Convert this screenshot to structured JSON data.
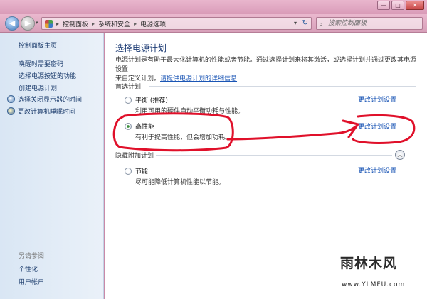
{
  "window": {
    "min_label": "—",
    "max_label": "□",
    "close_label": "✕"
  },
  "address_bar": {
    "back_icon": "back-arrow-icon",
    "forward_icon": "forward-arrow-icon",
    "breadcrumb": [
      "控制面板",
      "系统和安全",
      "电源选项"
    ],
    "separator": "▸",
    "dropdown": "▾",
    "refresh": "↻"
  },
  "search": {
    "placeholder": "搜索控制面板",
    "icon": "⌕"
  },
  "sidebar": {
    "home": "控制面板主页",
    "items": [
      {
        "label": "唤醒时需要密码"
      },
      {
        "label": "选择电源按钮的功能"
      },
      {
        "label": "创建电源计划"
      },
      {
        "label": "选择关闭显示器的时间"
      },
      {
        "label": "更改计算机睡眠时间"
      }
    ],
    "see_also": "另请参阅",
    "see_also_items": [
      {
        "label": "个性化"
      },
      {
        "label": "用户帐户"
      }
    ]
  },
  "main": {
    "title": "选择电源计划",
    "description_line1": "电源计划是有助于最大化计算机的性能或者节能。通过选择计划来将其激活，或选择计划并通过更改其电源设置",
    "description_line2": "来自定义计划。",
    "description_link": "请提供电源计划的详细信息",
    "preferred_group": "首选计划",
    "hidden_group": "隐藏附加计划",
    "collapse_icon": "︽",
    "change_label": "更改计划设置",
    "plans": [
      {
        "name": "平衡 (推荐)",
        "desc": "利用可用的硬件自动平衡功耗与性能。",
        "selected": false
      },
      {
        "name": "高性能",
        "desc": "有利于提高性能，但会增加功耗。",
        "selected": true
      },
      {
        "name": "节能",
        "desc": "尽可能降低计算机性能以节能。",
        "selected": false
      }
    ]
  },
  "colors": {
    "annotation": "#e0102a",
    "link": "#1a55b5",
    "title": "#1c3b74"
  },
  "watermark": {
    "title": "雨林木风",
    "url": "www.YLMFU.com"
  }
}
